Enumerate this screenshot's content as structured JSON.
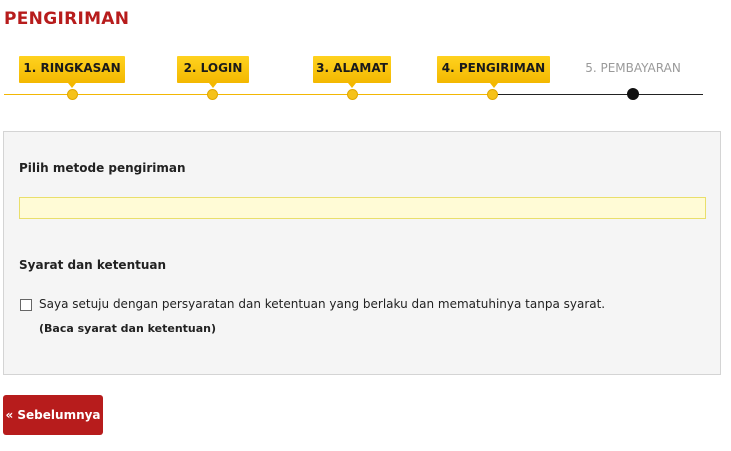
{
  "page": {
    "title": "PENGIRIMAN"
  },
  "steps": [
    {
      "label": "1. RINGKASAN",
      "state": "done"
    },
    {
      "label": "2. LOGIN",
      "state": "done"
    },
    {
      "label": "3. ALAMAT",
      "state": "done"
    },
    {
      "label": "4. PENGIRIMAN",
      "state": "current"
    },
    {
      "label": "5. PEMBAYARAN",
      "state": "todo"
    }
  ],
  "shipping": {
    "heading": "Pilih metode pengiriman",
    "selected": ""
  },
  "terms": {
    "heading": "Syarat dan ketentuan",
    "agree_label": "Saya setuju dengan persyaratan dan ketentuan yang berlaku dan mematuhinya tanpa syarat.",
    "read_link": "(Baca syarat dan ketentuan)",
    "checked": false
  },
  "actions": {
    "previous_label": "« Sebelumnya"
  },
  "colors": {
    "brand_red": "#b71c1c",
    "step_yellow": "#f3b800",
    "highlight_field": "#fffbd6"
  }
}
